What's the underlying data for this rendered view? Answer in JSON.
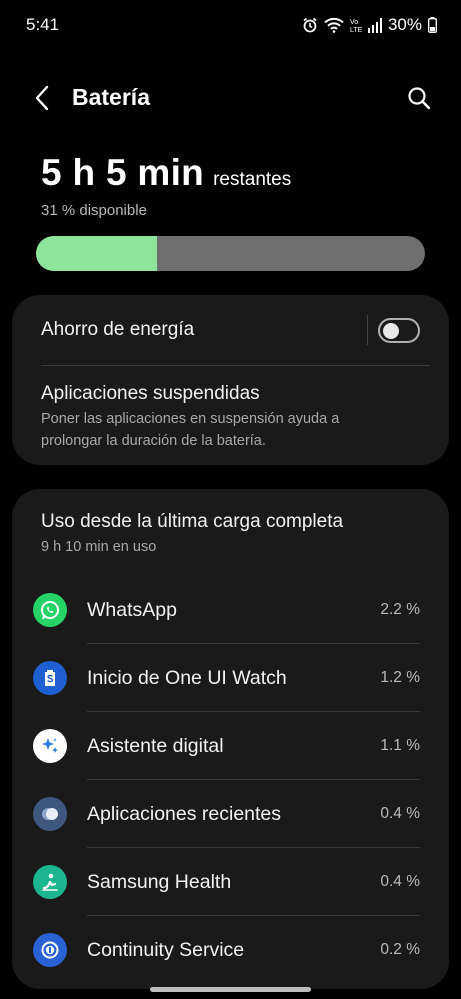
{
  "status_bar": {
    "time": "5:41",
    "battery_percent": "30%",
    "icons": [
      "alarm-icon",
      "wifi-icon",
      "volte-icon",
      "signal-icon",
      "battery-icon"
    ]
  },
  "header": {
    "title": "Batería",
    "back_icon": "back-arrow-icon",
    "search_icon": "search-icon"
  },
  "battery": {
    "remaining_value": "5 h 5 min",
    "remaining_suffix": "restantes",
    "available_text": "31 % disponible",
    "level_percent": 31,
    "fill_color": "#8de49a"
  },
  "power_saving": {
    "label": "Ahorro de energía",
    "enabled": false
  },
  "suspended_apps": {
    "label": "Aplicaciones suspendidas",
    "description_line1": "Poner las aplicaciones en suspensión ayuda a",
    "description_line2": "prolongar la duración de la batería."
  },
  "usage": {
    "title": "Uso desde la última carga completa",
    "subtitle": "9 h 10 min en uso",
    "apps": [
      {
        "name": "WhatsApp",
        "percent": "2.2 %",
        "icon": "whatsapp-icon",
        "color": "#25d366"
      },
      {
        "name": "Inicio de One UI Watch",
        "percent": "1.2 %",
        "icon": "galaxy-watch-icon",
        "color": "#1f5fd1"
      },
      {
        "name": "Asistente digital",
        "percent": "1.1 %",
        "icon": "digital-assistant-icon",
        "color": "#ffffff"
      },
      {
        "name": "Aplicaciones recientes",
        "percent": "0.4 %",
        "icon": "recent-apps-icon",
        "color": "#3f567e"
      },
      {
        "name": "Samsung Health",
        "percent": "0.4 %",
        "icon": "samsung-health-icon",
        "color": "#1bb58f"
      },
      {
        "name": "Continuity Service",
        "percent": "0.2 %",
        "icon": "continuity-service-icon",
        "color": "#2a62d6"
      }
    ]
  }
}
